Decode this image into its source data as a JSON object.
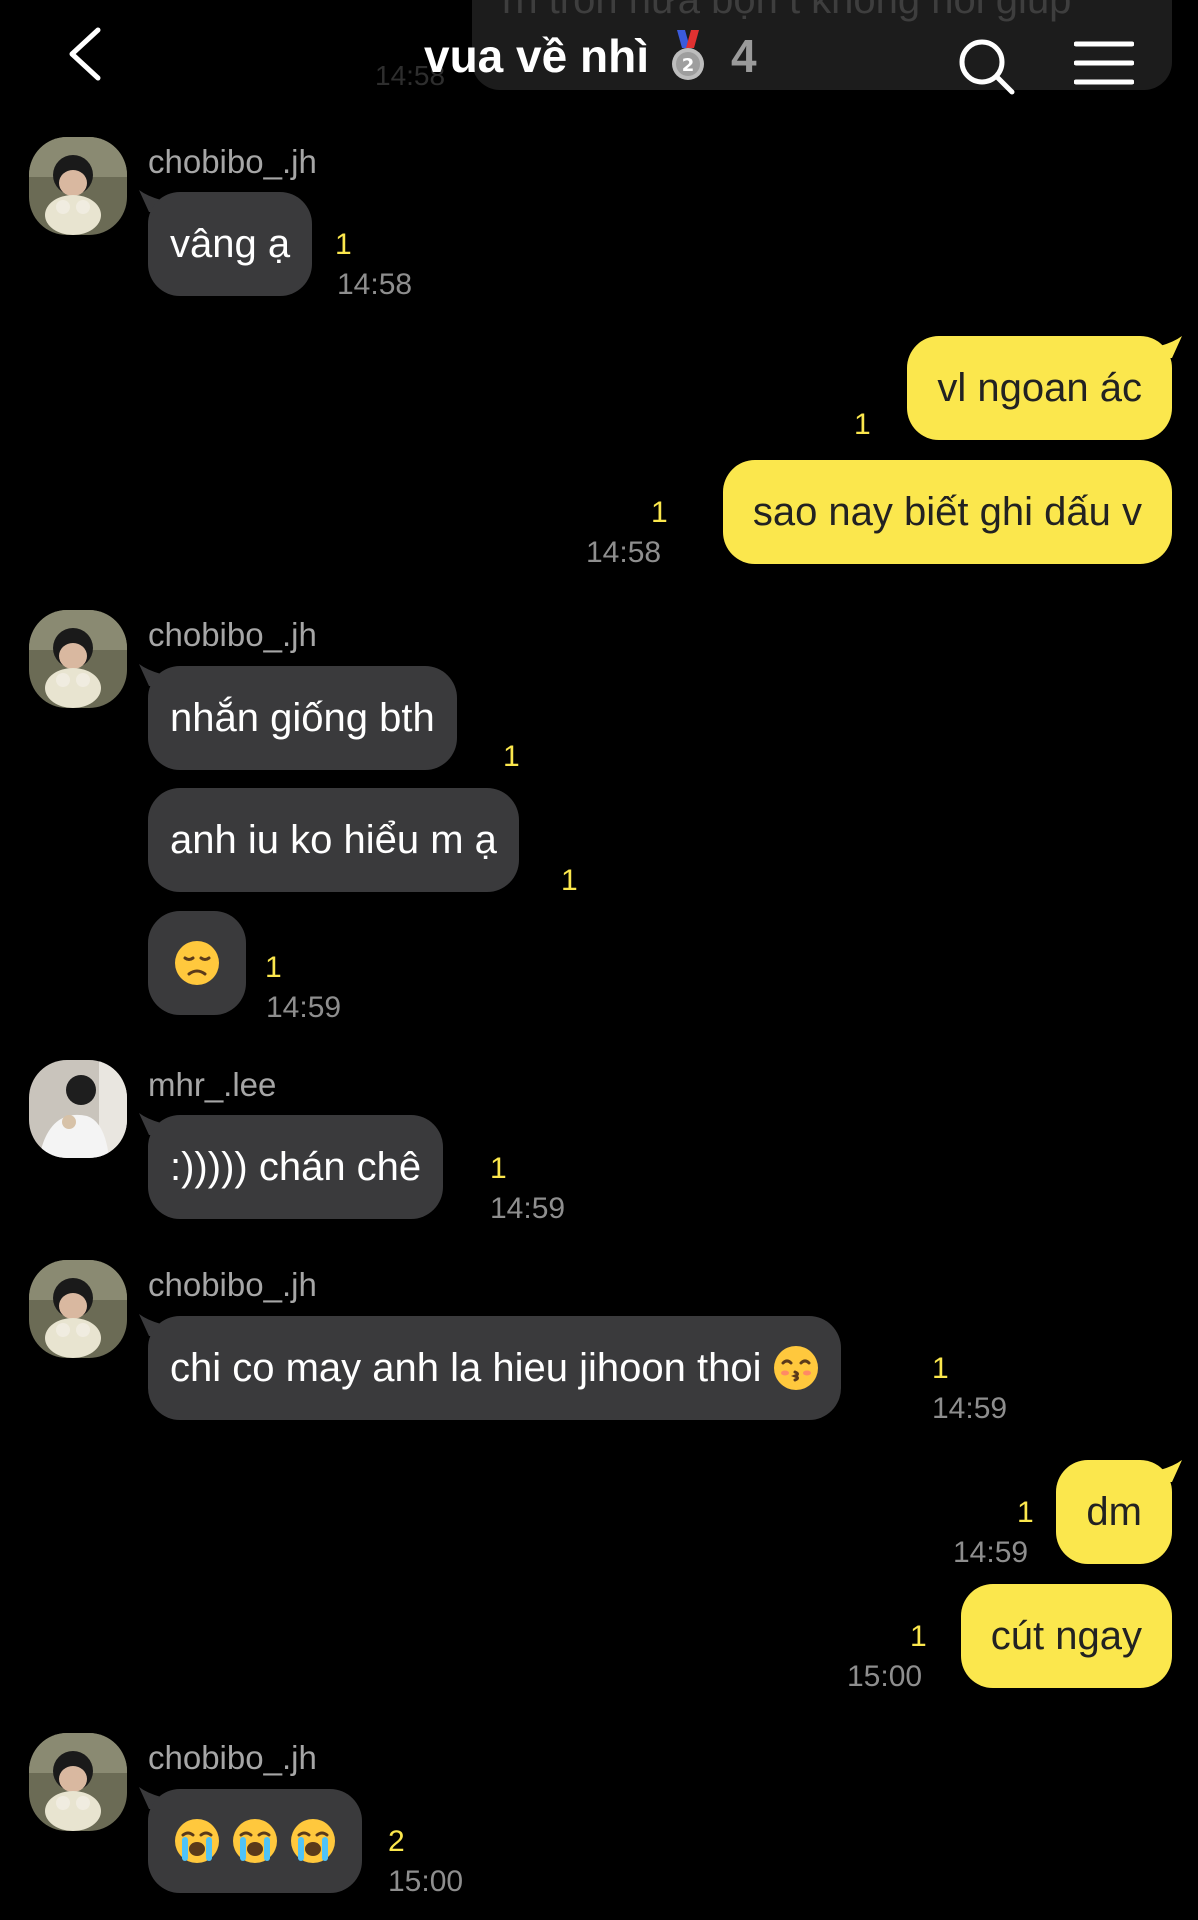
{
  "header": {
    "title": "vua về nhì",
    "medal_icon": "second-place-medal-icon",
    "member_count": "4",
    "background_preview_text": "rh trốn nữa bọn t không nói giúp",
    "background_preview_time": "14:58"
  },
  "colors": {
    "outgoing": "#fbe74d",
    "incoming": "#3a3a3c",
    "background": "#000000",
    "unread": "#fbe74d"
  },
  "messages": [
    {
      "sender": "chobibo_.jh",
      "text": "vâng ạ",
      "unread": "1",
      "time": "14:58"
    },
    {
      "text": "vl ngoan ác",
      "unread": "1"
    },
    {
      "text": "sao nay biết ghi dấu v",
      "unread": "1",
      "time": "14:58"
    },
    {
      "sender": "chobibo_.jh",
      "text": "nhắn giống bth",
      "unread": "1"
    },
    {
      "text": "anh iu ko hiểu m ạ",
      "unread": "1"
    },
    {
      "emoji": "disappointed-face-emoji",
      "unread": "1",
      "time": "14:59"
    },
    {
      "sender": "mhr_.lee",
      "text": ":))))) chán chê",
      "unread": "1",
      "time": "14:59"
    },
    {
      "sender": "chobibo_.jh",
      "text": "chi co may anh la hieu jihoon thoi",
      "emoji": "kissing-face-emoji",
      "unread": "1",
      "time": "14:59"
    },
    {
      "text": "dm",
      "unread": "1",
      "time": "14:59"
    },
    {
      "text": "cút ngay",
      "unread": "1",
      "time": "15:00"
    },
    {
      "sender": "chobibo_.jh",
      "emoji": "loudly-crying-face-emoji x3",
      "unread": "2",
      "time": "15:00"
    }
  ]
}
